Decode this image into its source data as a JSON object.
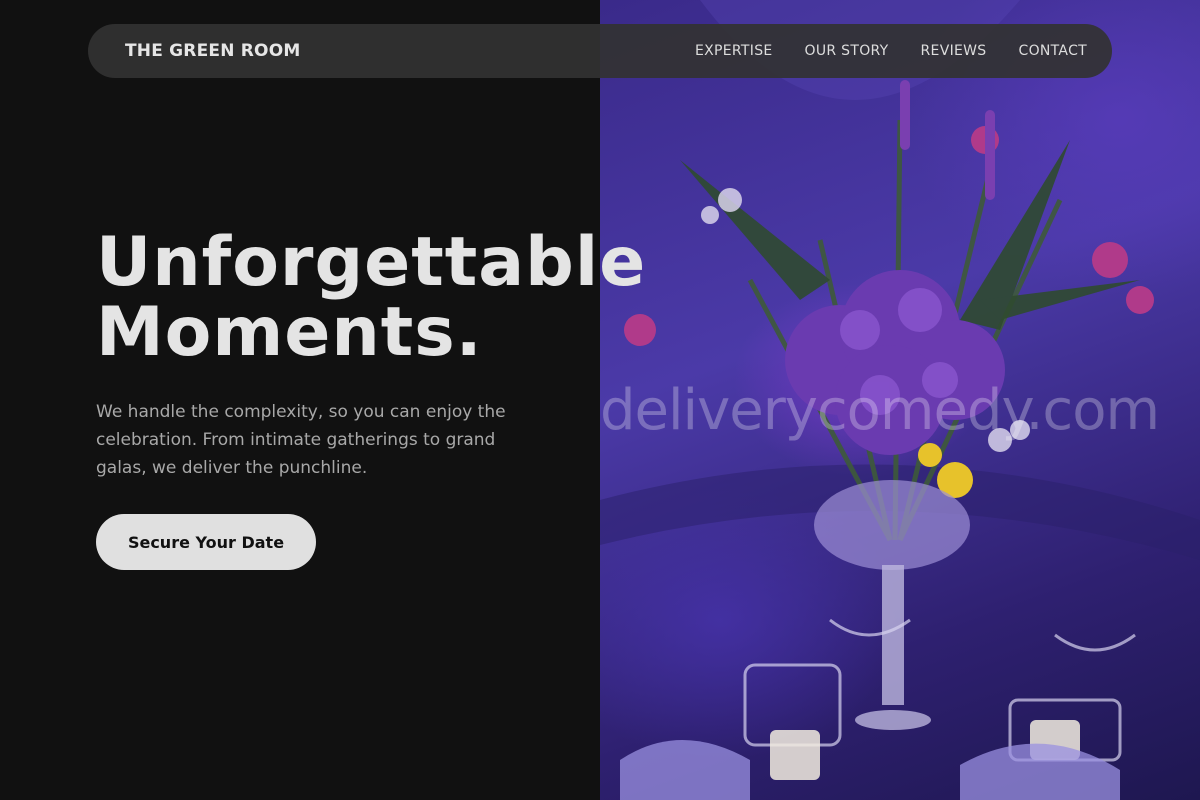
{
  "nav": {
    "brand": "THE GREEN ROOM",
    "links": [
      {
        "label": "EXPERTISE"
      },
      {
        "label": "OUR STORY"
      },
      {
        "label": "REVIEWS"
      },
      {
        "label": "CONTACT"
      }
    ]
  },
  "hero": {
    "title_line1": "Unforgettable",
    "title_line2": "Moments.",
    "subtitle": "We handle the complexity, so you can enjoy the celebration. From intimate gatherings to grand galas, we deliver the punchline.",
    "cta_label": "Secure Your Date"
  },
  "image": {
    "subject": "purple floral centerpiece in glass vase on banquet table with candles",
    "watermark": "deliverycomedy.com"
  },
  "colors": {
    "background": "#111111",
    "navbar": "#323232",
    "text_primary": "#e4e4e4",
    "text_secondary": "#a8a8a8",
    "button": "#e0e0e0",
    "image_tint": "#4b3aa8"
  }
}
